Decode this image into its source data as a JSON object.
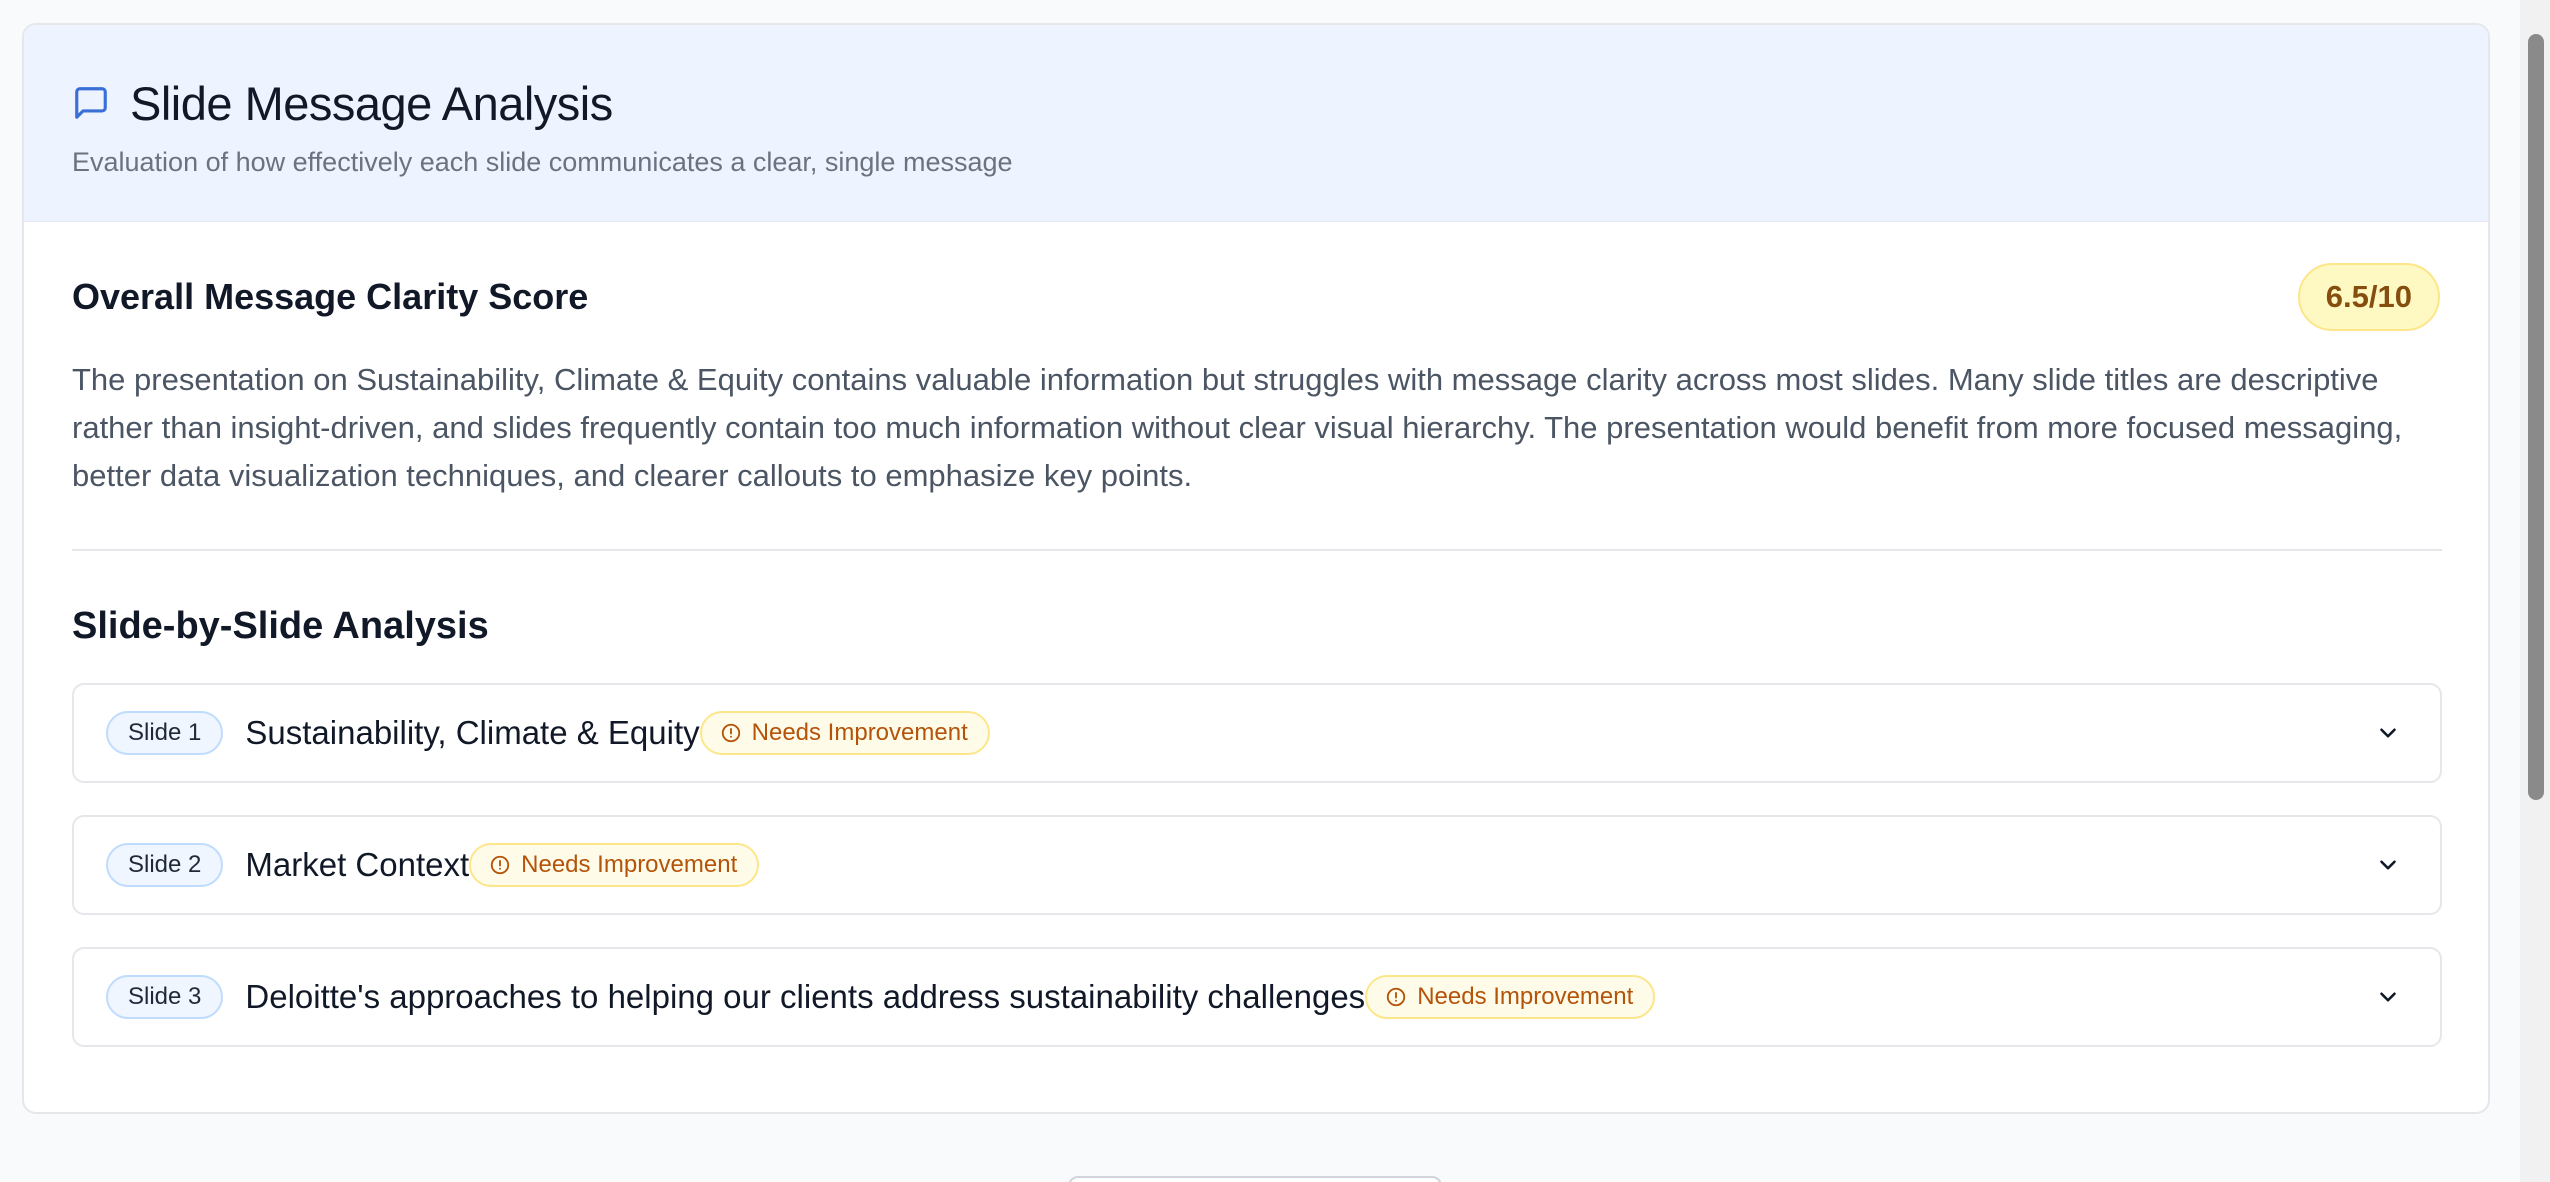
{
  "header": {
    "icon": "message-square-icon",
    "title": "Slide Message Analysis",
    "subtitle": "Evaluation of how effectively each slide communicates a clear, single message"
  },
  "overall": {
    "title": "Overall Message Clarity Score",
    "score": "6.5/10",
    "summary": "The presentation on Sustainability, Climate & Equity contains valuable information but struggles with message clarity across most slides. Many slide titles are descriptive rather than insight-driven, and slides frequently contain too much information without clear visual hierarchy. The presentation would benefit from more focused messaging, better data visualization techniques, and clearer callouts to emphasize key points."
  },
  "analysis": {
    "title": "Slide-by-Slide Analysis",
    "slides": [
      {
        "tag": "Slide 1",
        "title": "Sustainability, Climate & Equity",
        "status": "Needs Improvement"
      },
      {
        "tag": "Slide 2",
        "title": "Market Context",
        "status": "Needs Improvement"
      },
      {
        "tag": "Slide 3",
        "title": "Deloitte's approaches to helping our clients address sustainability challenges",
        "status": "Needs Improvement"
      }
    ]
  },
  "colors": {
    "header_bg": "#eef4ff",
    "accent_icon": "#3b6fd8",
    "score_badge_bg": "#fef9c3",
    "status_text": "#b45309"
  }
}
